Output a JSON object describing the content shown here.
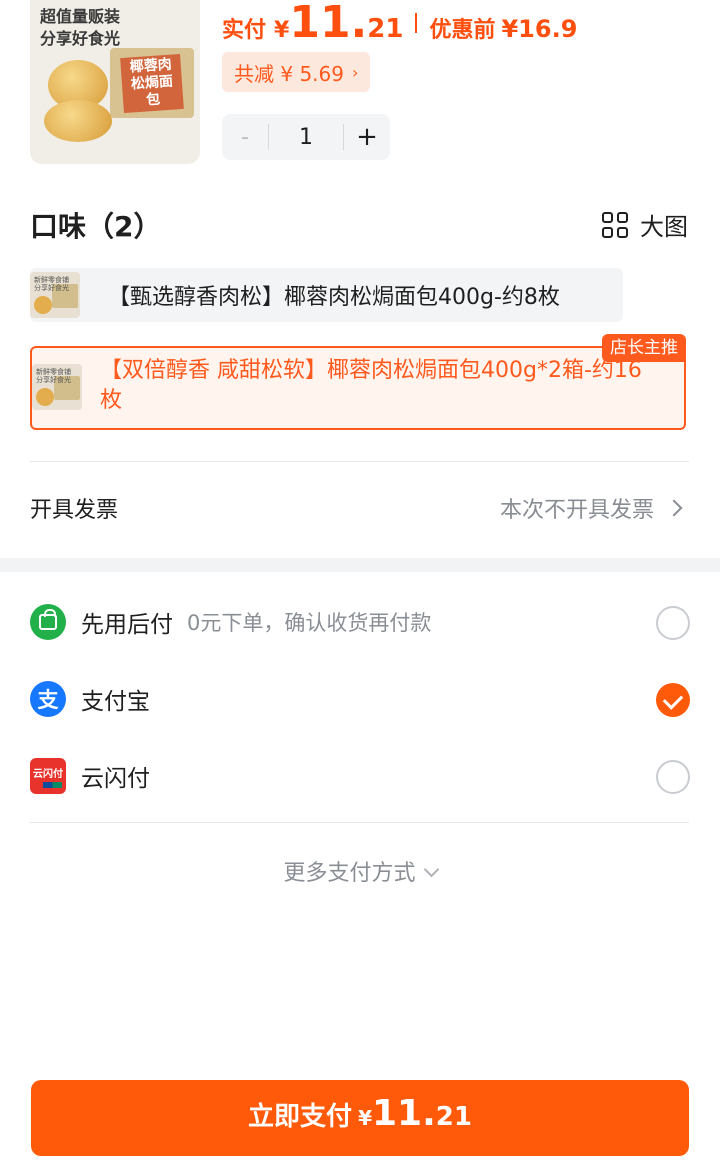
{
  "product": {
    "thumb_text": "超值量贩装\n分享好食光",
    "thumb_box_label": "椰蓉肉松焗面包",
    "price_label": "实付",
    "yen": "¥",
    "price_int": "11.",
    "price_dec": "21",
    "orig_label": "优惠前",
    "orig_price": "¥16.9",
    "discount": "共减 ¥ 5.69",
    "quantity": "1",
    "minus": "-",
    "plus": "+"
  },
  "flavor": {
    "title": "口味（2）",
    "big_image": "大图",
    "options": [
      {
        "label": "【甄选醇香肉松】椰蓉肉松焗面包400g-约8枚",
        "selected": false
      },
      {
        "label": "【双倍醇香 咸甜松软】椰蓉肉松焗面包400g*2箱-约16枚",
        "selected": true,
        "badge": "店长主推"
      }
    ],
    "thumb_small_text": "新鲜零食铺\n分享好食光"
  },
  "invoice": {
    "label": "开具发票",
    "value": "本次不开具发票"
  },
  "payment": {
    "methods": [
      {
        "name": "先用后付",
        "desc": "0元下单，确认收货再付款",
        "icon": "bag-icon",
        "checked": false
      },
      {
        "name": "支付宝",
        "desc": "",
        "icon": "alipay-icon",
        "icon_text": "支",
        "checked": true
      },
      {
        "name": "云闪付",
        "desc": "",
        "icon": "unionpay-icon",
        "icon_text": "云闪付",
        "checked": false
      }
    ],
    "more": "更多支付方式"
  },
  "pay_button": {
    "label": "立即支付",
    "yen": "¥",
    "int": "11.",
    "dec": "21"
  },
  "colors": {
    "accent": "#ff5a0a",
    "price": "#ff4f0f",
    "alipay": "#1677ff",
    "green": "#22b04a",
    "unionpay": "#e8332c"
  }
}
